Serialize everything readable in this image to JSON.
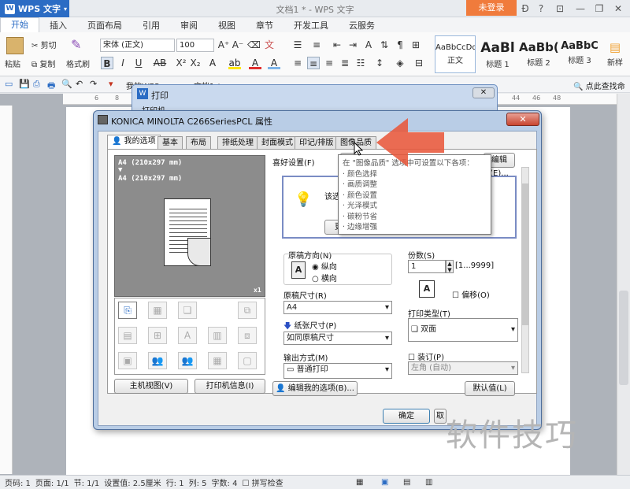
{
  "app": {
    "menu_label": "WPS 文字",
    "doc_title": "文档1 * - WPS 文字",
    "login": "未登录"
  },
  "ribbon_tabs": [
    "开始",
    "插入",
    "页面布局",
    "引用",
    "审阅",
    "视图",
    "章节",
    "开发工具",
    "云服务"
  ],
  "ribbon": {
    "paste": "粘贴",
    "cut": "剪切",
    "copy": "复制",
    "format_painter": "格式刷",
    "font": "宋体 (正文)",
    "size": "100",
    "styles": [
      {
        "preview": "AaBbCcDd",
        "name": "正文"
      },
      {
        "preview": "AaBl",
        "name": "标题 1"
      },
      {
        "preview": "AaBb(",
        "name": "标题 2"
      },
      {
        "preview": "AaBbC",
        "name": "标题 3"
      },
      {
        "preview": "",
        "name": "新样"
      }
    ]
  },
  "quick_access": {
    "tab1": "我的WPS",
    "tab2": "文档1 *",
    "search": "点此查找命令"
  },
  "ruler_marks": [
    "6",
    "8",
    "44",
    "46",
    "48"
  ],
  "print_dialog": {
    "title": "打印",
    "sub": "打印机"
  },
  "properties_dialog": {
    "title": "KONICA MINOLTA C266SeriesPCL 属性",
    "tabs": [
      "我的选项",
      "基本",
      "布局",
      "排纸处理",
      "封面模式",
      "印记/排版",
      "图像品质"
    ],
    "preview_line1": "A4 (210x297 mm)",
    "preview_line2": "A4 (210x297 mm)",
    "preview_scale": "x1",
    "fav_label": "喜好设置(F)",
    "fav_btn1": "自",
    "fav_btn2": "编辑(E)...",
    "info_text": "该选项",
    "info_btn": "更",
    "orientation_label": "原稿方向(N)",
    "portrait": "纵向",
    "landscape": "横向",
    "orig_size_label": "原稿尺寸(R)",
    "orig_size": "A4",
    "paper_size_label": "纸张尺寸(P)",
    "paper_size": "如同原稿尺寸",
    "output_label": "输出方式(M)",
    "output_value": "普通打印",
    "copies_label": "份数(S)",
    "copies": "1",
    "copies_range": "[1...9999]",
    "offset_label": "偏移(O)",
    "print_type_label": "打印类型(T)",
    "print_type": "双面",
    "binding_label": "装订(P)",
    "binding_pos": "左角 (自动)",
    "btn_printer_view": "主机视图(V)",
    "btn_printer_info": "打印机信息(I)",
    "btn_edit_options": "编辑我的选项(B)...",
    "btn_default": "默认值(L)",
    "btn_ok": "确定",
    "btn_cancel": "取"
  },
  "tooltip": {
    "header": "在 \"图像品质\" 选项中可设置以下各项：",
    "items": [
      "· 颜色选择",
      "· 画质调整",
      "· 颜色设置",
      "· 光泽模式",
      "· 碳粉节省",
      "· 边缘增强"
    ]
  },
  "status": {
    "page_no": "页码: 1",
    "pages": "页面: 1/1",
    "section": "节: 1/1",
    "setting": "设置值: 2.5厘米",
    "row": "行: 1",
    "col": "列: 5",
    "chars": "字数: 4",
    "spell": "拼写检查"
  },
  "watermark": "软件技巧",
  "colors": {
    "accent": "#2b6cc4",
    "login": "#f07b3c",
    "arrow": "#e8583b"
  }
}
